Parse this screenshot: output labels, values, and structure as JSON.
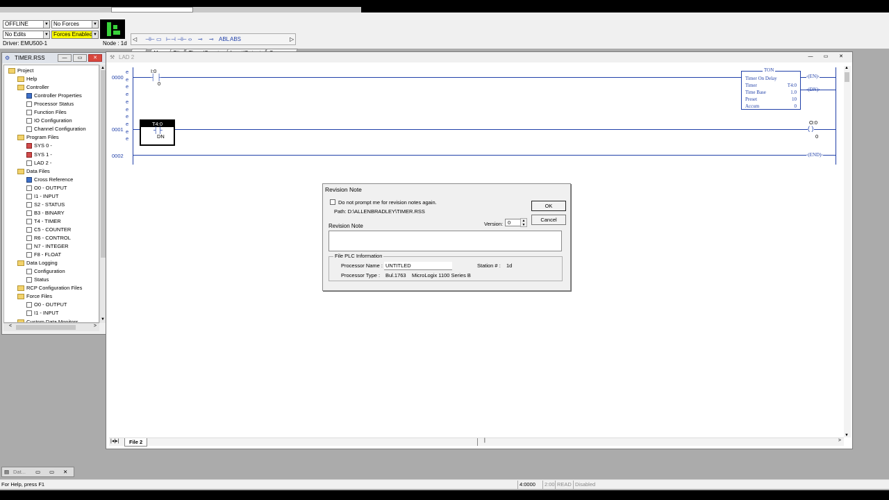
{
  "toolbar": {
    "mode": "OFFLINE",
    "forces": "No Forces",
    "edits": "No Edits",
    "forces_enabled": "Forces Enabled",
    "driver": "Driver: EMU500-1",
    "node": "Node : 1d",
    "tabs": [
      "User",
      "Bit",
      "Timer/Counter",
      "Input/Output",
      "Compare"
    ],
    "icon_names": [
      "contact-icon",
      "timer-icon",
      "branch-icon",
      "coil-icon",
      "latch-icon",
      "unlatch-icon",
      "abl-icon",
      "abs-icon"
    ]
  },
  "project_window": {
    "title": "TIMER.RSS",
    "tree": [
      {
        "label": "Project",
        "level": 0,
        "icon": "folder"
      },
      {
        "label": "Help",
        "level": 1,
        "icon": "folder"
      },
      {
        "label": "Controller",
        "level": 1,
        "icon": "folder"
      },
      {
        "label": "Controller Properties",
        "level": 2,
        "icon": "blue"
      },
      {
        "label": "Processor Status",
        "level": 2,
        "icon": "page"
      },
      {
        "label": "Function Files",
        "level": 2,
        "icon": "page"
      },
      {
        "label": "IO Configuration",
        "level": 2,
        "icon": "page"
      },
      {
        "label": "Channel Configuration",
        "level": 2,
        "icon": "page"
      },
      {
        "label": "Program Files",
        "level": 1,
        "icon": "folder"
      },
      {
        "label": "SYS 0 -",
        "level": 2,
        "icon": "red"
      },
      {
        "label": "SYS 1 -",
        "level": 2,
        "icon": "red"
      },
      {
        "label": "LAD 2 -",
        "level": 2,
        "icon": "page"
      },
      {
        "label": "Data Files",
        "level": 1,
        "icon": "folder"
      },
      {
        "label": "Cross Reference",
        "level": 2,
        "icon": "blue"
      },
      {
        "label": "O0 - OUTPUT",
        "level": 2,
        "icon": "page"
      },
      {
        "label": "I1 - INPUT",
        "level": 2,
        "icon": "page"
      },
      {
        "label": "S2 - STATUS",
        "level": 2,
        "icon": "page"
      },
      {
        "label": "B3 - BINARY",
        "level": 2,
        "icon": "page"
      },
      {
        "label": "T4 - TIMER",
        "level": 2,
        "icon": "page"
      },
      {
        "label": "C5 - COUNTER",
        "level": 2,
        "icon": "page"
      },
      {
        "label": "R6 - CONTROL",
        "level": 2,
        "icon": "page"
      },
      {
        "label": "N7 - INTEGER",
        "level": 2,
        "icon": "page"
      },
      {
        "label": "F8 - FLOAT",
        "level": 2,
        "icon": "page"
      },
      {
        "label": "Data Logging",
        "level": 1,
        "icon": "folder"
      },
      {
        "label": "Configuration",
        "level": 2,
        "icon": "page"
      },
      {
        "label": "Status",
        "level": 2,
        "icon": "page"
      },
      {
        "label": "RCP Configuration Files",
        "level": 1,
        "icon": "folder"
      },
      {
        "label": "Force Files",
        "level": 1,
        "icon": "folder"
      },
      {
        "label": "O0 - OUTPUT",
        "level": 2,
        "icon": "page"
      },
      {
        "label": "I1 - INPUT",
        "level": 2,
        "icon": "page"
      },
      {
        "label": "Custom Data Monitors",
        "level": 1,
        "icon": "folder"
      }
    ]
  },
  "ladder_window": {
    "title": "LAD 2",
    "rungs": [
      "0000",
      "0001",
      "0002"
    ],
    "contact_addr": "I:0",
    "contact_bit": "0",
    "ton": {
      "header": "TON",
      "rows": [
        {
          "label": "Timer On Delay",
          "value": ""
        },
        {
          "label": "Timer",
          "value": "T4:0"
        },
        {
          "label": "Time Base",
          "value": "1.0"
        },
        {
          "label": "Preset",
          "value": "10"
        },
        {
          "label": "Accum",
          "value": "0"
        }
      ],
      "en": "EN",
      "dn": "DN"
    },
    "dn_contact_addr": "T4:0",
    "dn_contact_bit": "DN",
    "out_addr": "O:0",
    "out_bit": "0",
    "end": "END",
    "file_tab": "File 2"
  },
  "dialog": {
    "title": "Revision Note",
    "checkbox_label": "Do not prompt me for revision notes again.",
    "path": "Path: D:\\ALLENBRADLEY\\TIMER.RSS",
    "note_label": "Revision Note",
    "version_label": "Version:",
    "version_value": "0",
    "ok": "OK",
    "cancel": "Cancel",
    "group_label": "File PLC Information",
    "processor_name_label": "Processor Name :",
    "processor_name": "UNTITLED",
    "station_label": "Station # :",
    "station": "1d",
    "processor_type_label": "Processor Type :",
    "processor_type_bul": "Bul.1763",
    "processor_type": "MicroLogix 1100 Series B"
  },
  "minimized": {
    "label": "Dat..."
  },
  "statusbar": {
    "help": "For Help, press F1",
    "addr": "4:0000",
    "cell2": "2:00",
    "cell3": "READ",
    "cell4": "Disabled"
  }
}
